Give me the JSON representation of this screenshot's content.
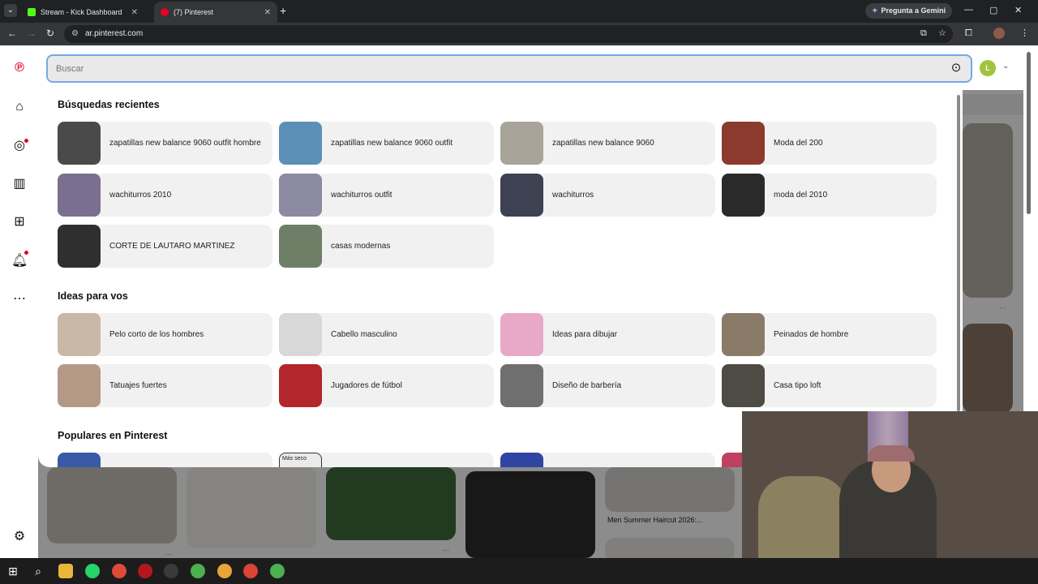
{
  "browser": {
    "tabs": [
      {
        "title": "Stream - Kick Dashboard",
        "favicon_color": "#53fc18",
        "active": false
      },
      {
        "title": "(7) Pinterest",
        "favicon_color": "#e60023",
        "active": true
      }
    ],
    "new_tab_symbol": "+",
    "gemini_label": "Pregunta a Gemini",
    "url": "ar.pinterest.com",
    "window_controls": [
      "—",
      "▢",
      "✕"
    ]
  },
  "search": {
    "placeholder": "Buscar",
    "avatar_initial": "L",
    "avatar_color": "#9fc43d",
    "focus_border_color": "#75a8e8"
  },
  "sections": {
    "recent": {
      "title": "Búsquedas recientes",
      "items": [
        {
          "label": "zapatillas new balance 9060 outfit hombre",
          "thumb": "#4a4a4a"
        },
        {
          "label": "zapatillas new balance 9060 outfit",
          "thumb": "#5b8fb5"
        },
        {
          "label": "zapatillas new balance 9060",
          "thumb": "#a8a49a"
        },
        {
          "label": "Moda del 200",
          "thumb": "#8c3a2e"
        },
        {
          "label": "wachiturros 2010",
          "thumb": "#7a6f8f"
        },
        {
          "label": "wachiturros outfit",
          "thumb": "#8b8aa0"
        },
        {
          "label": "wachiturros",
          "thumb": "#3d4152"
        },
        {
          "label": "moda del 2010",
          "thumb": "#2a2a2a"
        },
        {
          "label": "CORTE DE LAUTARO MARTINEZ",
          "thumb": "#2f2f2f"
        },
        {
          "label": "casas modernas",
          "thumb": "#6d7f66"
        }
      ]
    },
    "ideas": {
      "title": "Ideas para vos",
      "items": [
        {
          "label": "Pelo corto de los hombres",
          "thumb": "#c9b7a8"
        },
        {
          "label": "Cabello masculino",
          "thumb": "#d8d8d8"
        },
        {
          "label": "Ideas para dibujar",
          "thumb": "#e7a9c7"
        },
        {
          "label": "Peinados de hombre",
          "thumb": "#8a7a68"
        },
        {
          "label": "Tatuajes fuertes",
          "thumb": "#b49a86"
        },
        {
          "label": "Jugadores de fútbol",
          "thumb": "#b3262b"
        },
        {
          "label": "Diseño de barbería",
          "thumb": "#6f6f6f"
        },
        {
          "label": "Casa tipo loft",
          "thumb": "#4e4a44"
        }
      ]
    },
    "popular": {
      "title": "Populares en Pinterest",
      "peek_thumbs": [
        "#3a5aa8",
        "#eaeaea",
        "#3045a3",
        "#c04060"
      ],
      "peek_labels": [
        "Más",
        "seco"
      ]
    }
  },
  "feed": {
    "caption": "Men Summer Haircut 2026:...",
    "more_symbol": "···"
  },
  "colors": {
    "pinterest_red": "#e60023",
    "chrome_dark": "#202124",
    "chrome_toolbar": "#35363a"
  },
  "rail_icons": [
    "pinterest-logo",
    "home-icon",
    "explore-icon",
    "boards-icon",
    "create-icon",
    "notifications-icon",
    "messages-icon",
    "settings-icon"
  ]
}
